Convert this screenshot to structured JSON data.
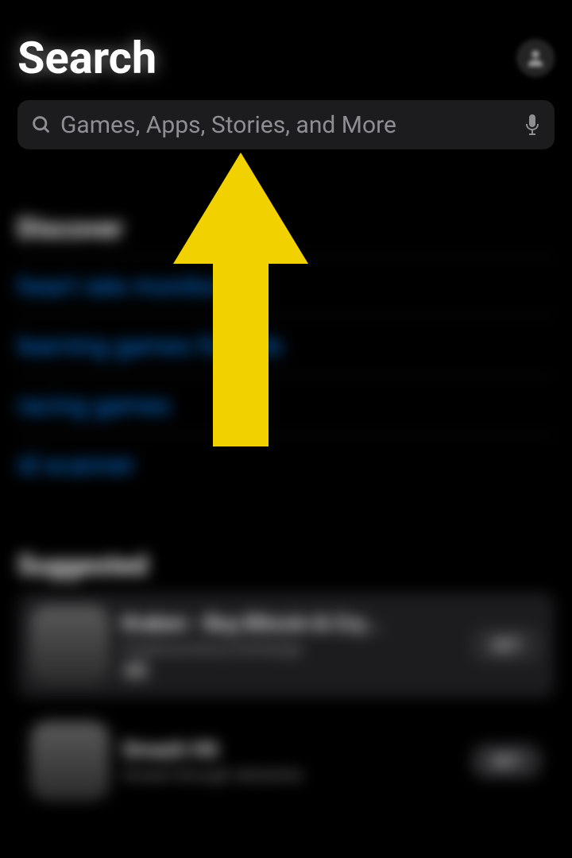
{
  "header": {
    "title": "Search"
  },
  "search": {
    "placeholder": "Games, Apps, Stories, and More"
  },
  "discover": {
    "heading": "Discover",
    "items": [
      "heart rate monitor",
      "learning games for kids",
      "racing games",
      "id scanner"
    ]
  },
  "suggested": {
    "heading": "Suggested",
    "apps": [
      {
        "name": "Kraken - Buy Bitcoin & Cry...",
        "subtitle": "Cryptocurrency Exchange",
        "badge": "Ad",
        "action": "GET"
      },
      {
        "name": "Smash Hit",
        "subtitle": "Smash through obstacles",
        "action": "GET"
      }
    ]
  },
  "arrow": {
    "color": "#f2d100"
  }
}
